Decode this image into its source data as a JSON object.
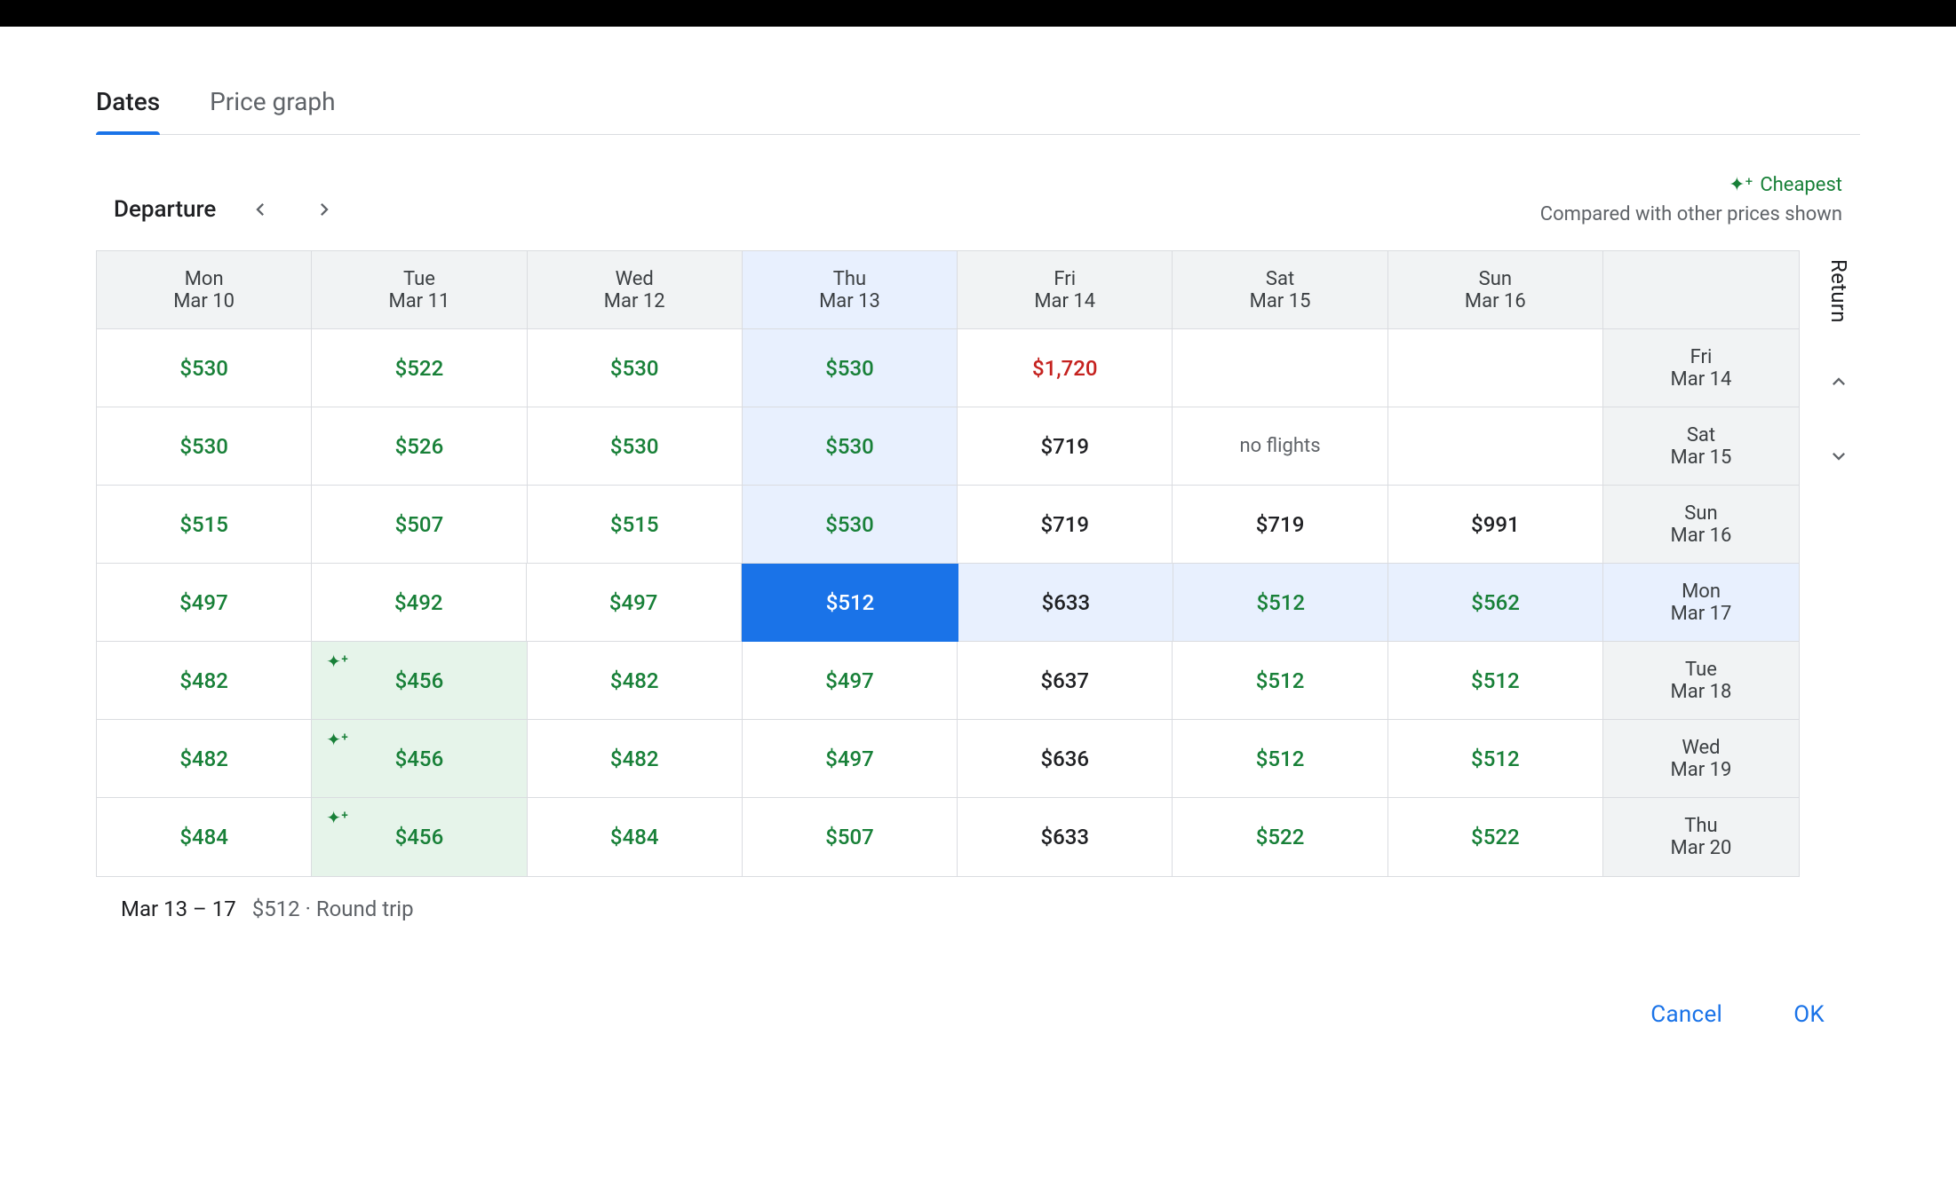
{
  "tabs": {
    "dates": "Dates",
    "price_graph": "Price graph"
  },
  "departure_label": "Departure",
  "return_label": "Return",
  "legend": {
    "cheapest": "Cheapest",
    "compared": "Compared with other prices shown"
  },
  "depart_columns": [
    {
      "dow": "Mon",
      "date": "Mar 10"
    },
    {
      "dow": "Tue",
      "date": "Mar 11"
    },
    {
      "dow": "Wed",
      "date": "Mar 12"
    },
    {
      "dow": "Thu",
      "date": "Mar 13"
    },
    {
      "dow": "Fri",
      "date": "Mar 14"
    },
    {
      "dow": "Sat",
      "date": "Mar 15"
    },
    {
      "dow": "Sun",
      "date": "Mar 16"
    }
  ],
  "return_rows": [
    {
      "dow": "Fri",
      "date": "Mar 14"
    },
    {
      "dow": "Sat",
      "date": "Mar 15"
    },
    {
      "dow": "Sun",
      "date": "Mar 16"
    },
    {
      "dow": "Mon",
      "date": "Mar 17"
    },
    {
      "dow": "Tue",
      "date": "Mar 18"
    },
    {
      "dow": "Wed",
      "date": "Mar 19"
    },
    {
      "dow": "Thu",
      "date": "Mar 20"
    }
  ],
  "selected_col": 3,
  "selected_row": 3,
  "grid": [
    [
      {
        "text": "$530",
        "tone": "green"
      },
      {
        "text": "$522",
        "tone": "green"
      },
      {
        "text": "$530",
        "tone": "green"
      },
      {
        "text": "$530",
        "tone": "green"
      },
      {
        "text": "$1,720",
        "tone": "red"
      },
      {
        "text": "",
        "tone": "empty"
      },
      {
        "text": "",
        "tone": "empty"
      }
    ],
    [
      {
        "text": "$530",
        "tone": "green"
      },
      {
        "text": "$526",
        "tone": "green"
      },
      {
        "text": "$530",
        "tone": "green"
      },
      {
        "text": "$530",
        "tone": "green"
      },
      {
        "text": "$719",
        "tone": "black"
      },
      {
        "text": "no flights",
        "tone": "muted"
      },
      {
        "text": "",
        "tone": "empty"
      }
    ],
    [
      {
        "text": "$515",
        "tone": "green"
      },
      {
        "text": "$507",
        "tone": "green"
      },
      {
        "text": "$515",
        "tone": "green"
      },
      {
        "text": "$530",
        "tone": "green"
      },
      {
        "text": "$719",
        "tone": "black"
      },
      {
        "text": "$719",
        "tone": "black"
      },
      {
        "text": "$991",
        "tone": "black"
      }
    ],
    [
      {
        "text": "$497",
        "tone": "green"
      },
      {
        "text": "$492",
        "tone": "green"
      },
      {
        "text": "$497",
        "tone": "green"
      },
      {
        "text": "$512",
        "tone": "green",
        "selected": true
      },
      {
        "text": "$633",
        "tone": "black"
      },
      {
        "text": "$512",
        "tone": "green"
      },
      {
        "text": "$562",
        "tone": "green"
      }
    ],
    [
      {
        "text": "$482",
        "tone": "green"
      },
      {
        "text": "$456",
        "tone": "green",
        "cheapest": true
      },
      {
        "text": "$482",
        "tone": "green"
      },
      {
        "text": "$497",
        "tone": "green"
      },
      {
        "text": "$637",
        "tone": "black"
      },
      {
        "text": "$512",
        "tone": "green"
      },
      {
        "text": "$512",
        "tone": "green"
      }
    ],
    [
      {
        "text": "$482",
        "tone": "green"
      },
      {
        "text": "$456",
        "tone": "green",
        "cheapest": true
      },
      {
        "text": "$482",
        "tone": "green"
      },
      {
        "text": "$497",
        "tone": "green"
      },
      {
        "text": "$636",
        "tone": "black"
      },
      {
        "text": "$512",
        "tone": "green"
      },
      {
        "text": "$512",
        "tone": "green"
      }
    ],
    [
      {
        "text": "$484",
        "tone": "green"
      },
      {
        "text": "$456",
        "tone": "green",
        "cheapest": true
      },
      {
        "text": "$484",
        "tone": "green"
      },
      {
        "text": "$507",
        "tone": "green"
      },
      {
        "text": "$633",
        "tone": "black"
      },
      {
        "text": "$522",
        "tone": "green"
      },
      {
        "text": "$522",
        "tone": "green"
      }
    ]
  ],
  "footer": {
    "range": "Mar 13 – 17",
    "detail": "$512 · Round trip"
  },
  "actions": {
    "cancel": "Cancel",
    "ok": "OK"
  }
}
